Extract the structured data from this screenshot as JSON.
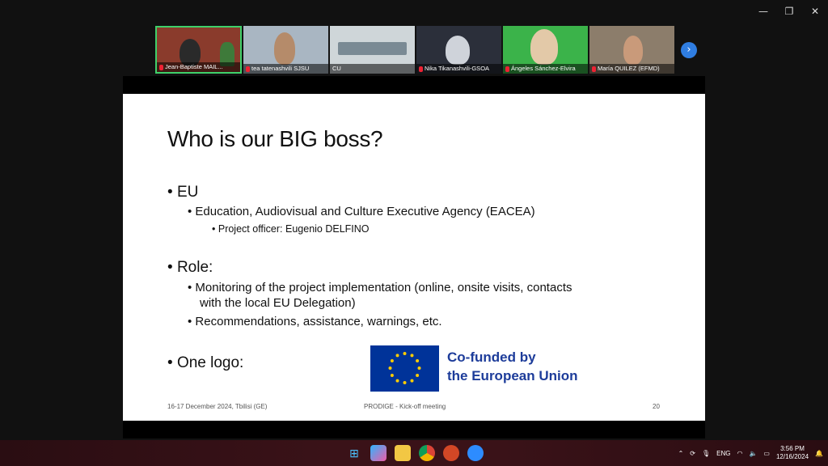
{
  "window": {
    "minimize": "—",
    "restore": "❐",
    "close": "✕"
  },
  "participants": [
    {
      "name": "Jean-Baptiste MAIL...",
      "bg": "#8a3b2c",
      "active": true
    },
    {
      "name": "tea tatenashvili SJSU",
      "bg": "#a9b6c2",
      "active": false
    },
    {
      "name": "CU",
      "bg": "#cfd6d9",
      "active": false
    },
    {
      "name": "Nika Tikanashvili-GSOA",
      "bg": "#2b2f3a",
      "active": false
    },
    {
      "name": "Ángeles Sánchez-Elvira",
      "bg": "#3bb34a",
      "active": false
    },
    {
      "name": "María QUILEZ (EFMD)",
      "bg": "#8c7d6b",
      "active": false
    }
  ],
  "strip_next": "›",
  "slide": {
    "title": "Who is our BIG boss?",
    "bullets": {
      "eu": "EU",
      "agency": "Education, Audiovisual and Culture Executive Agency (EACEA)",
      "officer": "Project officer: Eugenio DELFINO",
      "role": "Role:",
      "monitoring_1": "Monitoring of the project implementation (online, onsite visits, contacts",
      "monitoring_2": "with the local EU Delegation)",
      "recommend": "Recommendations, assistance, warnings, etc.",
      "logo": "One logo:"
    },
    "cofund_1": "Co-funded by",
    "cofund_2": "the European Union",
    "footer_left": "16-17 December 2024, Tbilisi (GE)",
    "footer_center": "PRODIGE - Kick-off meeting",
    "page": "20"
  },
  "taskbar": {
    "lang": "ENG",
    "time": "3:56 PM",
    "date": "12/16/2024"
  }
}
